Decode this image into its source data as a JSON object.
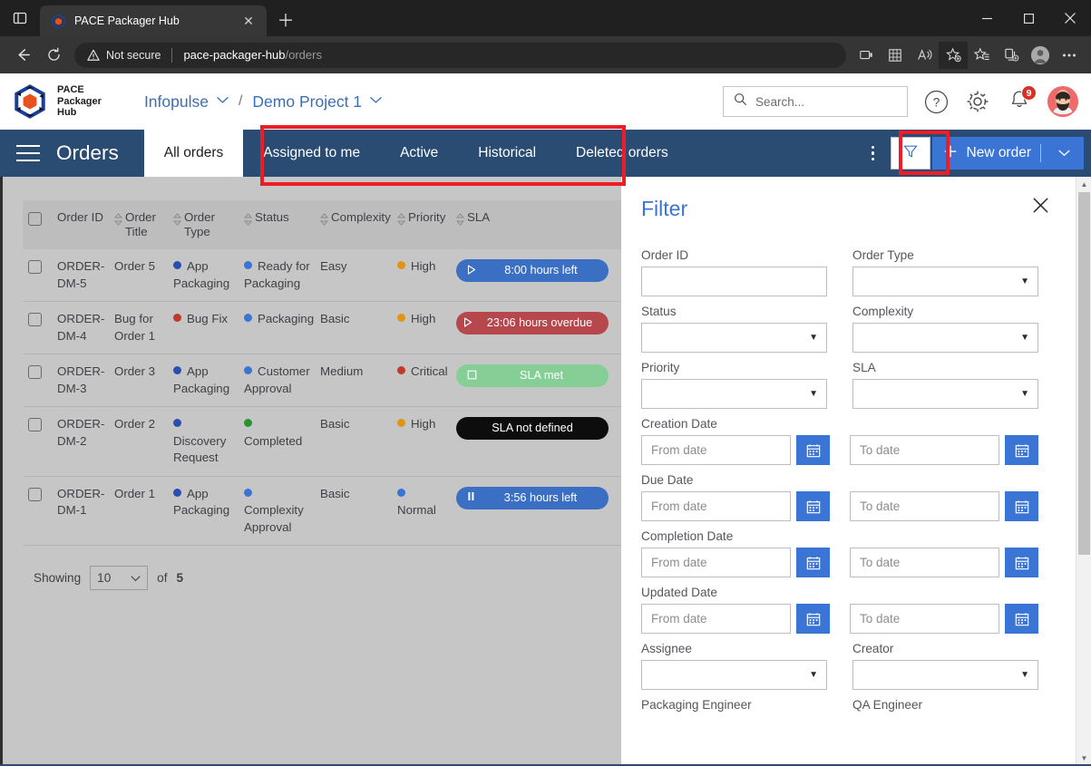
{
  "browser": {
    "tab_title": "PACE Packager Hub",
    "tab_close_icon": "close-icon",
    "new_tab_icon": "plus-icon",
    "minimize_icon": "minimize-icon",
    "maximize_icon": "maximize-icon",
    "close_window_icon": "close-icon",
    "back_icon": "back-arrow-icon",
    "reload_icon": "reload-icon",
    "security_label": "Not secure",
    "url_host": "pace-packager-hub",
    "url_path": "/orders",
    "toolbar_icons": [
      "cast-icon",
      "apps-icon",
      "read-aloud-icon",
      "add-favorite-icon",
      "favorites-icon",
      "collections-icon",
      "profile-icon",
      "settings-more-icon"
    ]
  },
  "header": {
    "brand_line1": "PACE",
    "brand_line2": "Packager",
    "brand_line3": "Hub",
    "breadcrumb": {
      "org": "Infopulse",
      "separator": "/",
      "project": "Demo Project 1",
      "caret_icon": "chevron-down-icon"
    },
    "search": {
      "placeholder": "Search...",
      "icon": "search-icon"
    },
    "help_icon": "help-circle-icon",
    "settings_icon": "gear-icon",
    "notifications_icon": "bell-icon",
    "notifications_count": "9",
    "avatar_icon": "user-avatar"
  },
  "orders_bar": {
    "menu_icon": "hamburger-menu-icon",
    "title": "Orders",
    "tabs": [
      {
        "label": "All orders",
        "active": true
      },
      {
        "label": "Assigned to me",
        "active": false
      },
      {
        "label": "Active",
        "active": false
      },
      {
        "label": "Historical",
        "active": false
      },
      {
        "label": "Deleted orders",
        "active": false
      }
    ],
    "kebab_icon": "more-vertical-icon",
    "filter_icon": "funnel-filter-icon",
    "new_order_label": "New order",
    "new_order_plus_icon": "plus-icon",
    "new_order_caret_icon": "chevron-down-icon"
  },
  "table": {
    "columns": [
      {
        "label": "Order ID",
        "sortable": true
      },
      {
        "label": "Order Title",
        "sortable": true
      },
      {
        "label": "Order Type",
        "sortable": true
      },
      {
        "label": "Status",
        "sortable": true
      },
      {
        "label": "Complexity",
        "sortable": true
      },
      {
        "label": "Priority",
        "sortable": true
      },
      {
        "label": "SLA",
        "sortable": false
      }
    ],
    "select_all_icon": "checkbox-unchecked-icon",
    "rows": [
      {
        "order_id": "ORDER-DM-5",
        "order_title": "Order 5",
        "order_type": "App Packaging",
        "order_type_color": "#2a4fb3",
        "status": "Ready for Packaging",
        "status_color": "#3a74d4",
        "complexity": "Easy",
        "priority": "High",
        "priority_color": "#e09413",
        "sla_text": "8:00 hours left",
        "sla_bg": "#3a6fc4",
        "sla_icon": "play-triangle-icon"
      },
      {
        "order_id": "ORDER-DM-4",
        "order_title": "Bug for Order 1",
        "order_type": "Bug Fix",
        "order_type_color": "#c0392b",
        "status": "Packaging",
        "status_color": "#3a74d4",
        "complexity": "Basic",
        "priority": "High",
        "priority_color": "#e09413",
        "sla_text": "23:06 hours overdue",
        "sla_bg": "#b5474d",
        "sla_icon": "play-triangle-icon"
      },
      {
        "order_id": "ORDER-DM-3",
        "order_title": "Order 3",
        "order_type": "App Packaging",
        "order_type_color": "#2a4fb3",
        "status": "Customer Approval",
        "status_color": "#3a74d4",
        "complexity": "Medium",
        "priority": "Critical",
        "priority_color": "#c0392b",
        "sla_text": "SLA met",
        "sla_bg": "#85cf96",
        "sla_icon": "stop-square-icon"
      },
      {
        "order_id": "ORDER-DM-2",
        "order_title": "Order 2",
        "order_type": "Discovery Request",
        "order_type_color": "#2a4fb3",
        "status": "Completed",
        "status_color": "#27962f",
        "complexity": "Basic",
        "priority": "High",
        "priority_color": "#e09413",
        "sla_text": "SLA not defined",
        "sla_bg": "#0d0d0d",
        "sla_icon": "none"
      },
      {
        "order_id": "ORDER-DM-1",
        "order_title": "Order 1",
        "order_type": "App Packaging",
        "order_type_color": "#2a4fb3",
        "status": "Complexity Approval",
        "status_color": "#3a74d4",
        "complexity": "Basic",
        "priority": "Normal",
        "priority_color": "#3a74d4",
        "sla_text": "3:56 hours left",
        "sla_bg": "#3a6fc4",
        "sla_icon": "pause-icon"
      }
    ],
    "footer": {
      "showing_label": "Showing",
      "page_size": "10",
      "of_label": "of",
      "total": "5",
      "caret_icon": "chevron-down-icon"
    }
  },
  "filter_panel": {
    "title": "Filter",
    "close_icon": "close-icon",
    "fields": [
      {
        "label": "Order ID",
        "type": "text",
        "value": ""
      },
      {
        "label": "Order Type",
        "type": "select",
        "value": ""
      },
      {
        "label": "Status",
        "type": "select",
        "value": ""
      },
      {
        "label": "Complexity",
        "type": "select",
        "value": ""
      },
      {
        "label": "Priority",
        "type": "select",
        "value": ""
      },
      {
        "label": "SLA",
        "type": "select",
        "value": ""
      }
    ],
    "date_fields": [
      {
        "label": "Creation Date",
        "from_placeholder": "From date",
        "to_placeholder": "To date"
      },
      {
        "label": "Due Date",
        "from_placeholder": "From date",
        "to_placeholder": "To date"
      },
      {
        "label": "Completion Date",
        "from_placeholder": "From date",
        "to_placeholder": "To date"
      },
      {
        "label": "Updated Date",
        "from_placeholder": "From date",
        "to_placeholder": "To date"
      }
    ],
    "people_fields": [
      {
        "label": "Assignee",
        "type": "select",
        "value": ""
      },
      {
        "label": "Creator",
        "type": "select",
        "value": ""
      },
      {
        "label": "Packaging Engineer",
        "type": "select",
        "value": ""
      },
      {
        "label": "QA Engineer",
        "type": "select",
        "value": ""
      }
    ],
    "calendar_icon": "calendar-icon",
    "select_caret_icon": "caret-down-icon"
  },
  "annotations": {
    "highlight_color": "#ee1c25",
    "boxes": [
      {
        "name": "tabs-group-highlight"
      },
      {
        "name": "filter-button-highlight"
      }
    ]
  },
  "scrollbar": {
    "up_icon": "caret-up-icon",
    "down_icon": "caret-down-icon"
  }
}
